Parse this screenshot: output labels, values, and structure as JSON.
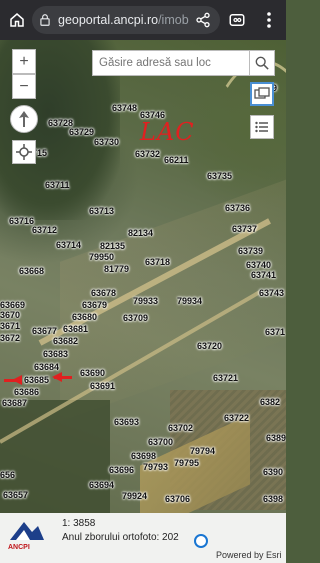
{
  "browser": {
    "url_host": "geoportal.ancpi.ro",
    "url_path": "/imob",
    "icons": [
      "home-icon",
      "site-info-icon",
      "share-icon",
      "tab-switcher-icon",
      "more-vert-icon"
    ]
  },
  "map": {
    "search_placeholder": "Găsire adresă sau loc",
    "zoom_in": "+",
    "zoom_out": "−",
    "annotation_text": "LAC",
    "parcels": [
      {
        "id": "63746",
        "label": "63746"
      },
      {
        "id": "63748",
        "label": "63748"
      },
      {
        "id": "63728",
        "label": "63728"
      },
      {
        "id": "63729",
        "label": "63729"
      },
      {
        "id": "63730",
        "label": "63730"
      },
      {
        "id": "63715",
        "label": "715"
      },
      {
        "id": "63732",
        "label": "63732"
      },
      {
        "id": "66211",
        "label": "66211"
      },
      {
        "id": "63735",
        "label": "63735"
      },
      {
        "id": "63711",
        "label": "63711"
      },
      {
        "id": "63713",
        "label": "63713"
      },
      {
        "id": "63736",
        "label": "63736"
      },
      {
        "id": "63716",
        "label": "63716"
      },
      {
        "id": "63712",
        "label": "63712"
      },
      {
        "id": "82134",
        "label": "82134"
      },
      {
        "id": "63737",
        "label": "63737"
      },
      {
        "id": "63714",
        "label": "63714"
      },
      {
        "id": "82135",
        "label": "82135"
      },
      {
        "id": "79950",
        "label": "79950"
      },
      {
        "id": "63739",
        "label": "63739"
      },
      {
        "id": "63718",
        "label": "63718"
      },
      {
        "id": "63740",
        "label": "63740"
      },
      {
        "id": "63668",
        "label": "63668"
      },
      {
        "id": "81779",
        "label": "81779"
      },
      {
        "id": "63741",
        "label": "63741"
      },
      {
        "id": "63678",
        "label": "63678"
      },
      {
        "id": "63743",
        "label": "63743"
      },
      {
        "id": "79933",
        "label": "79933"
      },
      {
        "id": "79934",
        "label": "79934"
      },
      {
        "id": "63669",
        "label": "63669"
      },
      {
        "id": "63679",
        "label": "63679"
      },
      {
        "id": "63670",
        "label": "3670"
      },
      {
        "id": "63680",
        "label": "63680"
      },
      {
        "id": "63709",
        "label": "63709"
      },
      {
        "id": "63671",
        "label": "3671"
      },
      {
        "id": "63681",
        "label": "63681"
      },
      {
        "id": "63677",
        "label": "63677"
      },
      {
        "id": "63672",
        "label": "3672"
      },
      {
        "id": "63682",
        "label": "63682"
      },
      {
        "id": "63720",
        "label": "63720"
      },
      {
        "id": "63683",
        "label": "63683"
      },
      {
        "id": "63684",
        "label": "63684"
      },
      {
        "id": "63690",
        "label": "63690"
      },
      {
        "id": "63721",
        "label": "63721"
      },
      {
        "id": "63685",
        "label": "63685"
      },
      {
        "id": "63691",
        "label": "63691"
      },
      {
        "id": "63686",
        "label": "63686"
      },
      {
        "id": "63687",
        "label": "63687"
      },
      {
        "id": "63693",
        "label": "63693"
      },
      {
        "id": "63722",
        "label": "63722"
      },
      {
        "id": "63702",
        "label": "63702"
      },
      {
        "id": "63700",
        "label": "63700"
      },
      {
        "id": "63698",
        "label": "63698"
      },
      {
        "id": "79794",
        "label": "79794"
      },
      {
        "id": "63696",
        "label": "63696"
      },
      {
        "id": "79793",
        "label": "79793"
      },
      {
        "id": "79795",
        "label": "79795"
      },
      {
        "id": "63694",
        "label": "63694"
      },
      {
        "id": "63656",
        "label": "656"
      },
      {
        "id": "63657",
        "label": "63657"
      },
      {
        "id": "79924",
        "label": "79924"
      },
      {
        "id": "63706",
        "label": "63706"
      },
      {
        "id": "63359",
        "label": "6359"
      },
      {
        "id": "63713b",
        "label": "6371"
      },
      {
        "id": "6382",
        "label": "6382"
      },
      {
        "id": "6389",
        "label": "6389"
      },
      {
        "id": "6390",
        "label": "6390"
      },
      {
        "id": "6398",
        "label": "6398"
      }
    ]
  },
  "footer": {
    "scale": "1: 3858",
    "ortho_label": "Anul zborului ortofoto: 202",
    "powered_by": "Powered by Esri",
    "logo": "ANCPI"
  }
}
